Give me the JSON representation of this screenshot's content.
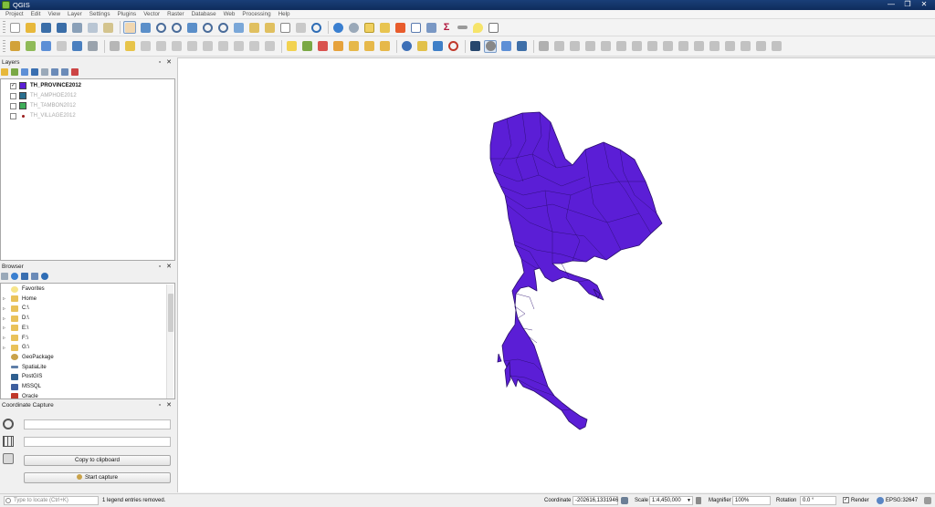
{
  "window": {
    "title": "QGIS",
    "minimize": "—",
    "maximize": "❐",
    "close": "✕"
  },
  "menus": [
    "Project",
    "Edit",
    "View",
    "Layer",
    "Settings",
    "Plugins",
    "Vector",
    "Raster",
    "Database",
    "Web",
    "Processing",
    "Help"
  ],
  "colors": {
    "province_fill": "#5b1ed6",
    "province_stroke": "#2a0e6e",
    "amphoe": "#2a6f8f",
    "tambon": "#3fae5a",
    "village": "#9b1c1c"
  },
  "layers_panel": {
    "title": "Layers",
    "layers": [
      {
        "name": "TH_PROVINCE2012",
        "checked": true,
        "symbol": "purple-fill"
      },
      {
        "name": "TH_AMPHOE2012",
        "checked": false,
        "symbol": "teal-fill"
      },
      {
        "name": "TH_TAMBON2012",
        "checked": false,
        "symbol": "green-fill"
      },
      {
        "name": "TH_VILLAGE2012",
        "checked": false,
        "symbol": "red-point"
      }
    ]
  },
  "browser_panel": {
    "title": "Browser",
    "items": [
      {
        "name": "Favorites",
        "icon": "star-icon"
      },
      {
        "name": "Home",
        "icon": "folder-icon"
      },
      {
        "name": "C:\\",
        "icon": "folder-icon"
      },
      {
        "name": "D:\\",
        "icon": "folder-icon"
      },
      {
        "name": "E:\\",
        "icon": "folder-icon"
      },
      {
        "name": "F:\\",
        "icon": "folder-icon"
      },
      {
        "name": "G:\\",
        "icon": "folder-icon"
      },
      {
        "name": "GeoPackage",
        "icon": "geopackage-icon"
      },
      {
        "name": "SpatiaLite",
        "icon": "spatialite-icon"
      },
      {
        "name": "PostGIS",
        "icon": "postgis-icon"
      },
      {
        "name": "MSSQL",
        "icon": "mssql-icon"
      },
      {
        "name": "Oracle",
        "icon": "oracle-icon"
      }
    ]
  },
  "coordinate_capture": {
    "title": "Coordinate Capture",
    "field1": "",
    "field2": "",
    "copy_label": "Copy to clipboard",
    "start_label": "Start capture"
  },
  "statusbar": {
    "locate_placeholder": "Type to locate (Ctrl+K)",
    "message": "1 legend entries removed.",
    "coordinate_label": "Coordinate",
    "coordinate_value": "-202616,1331946",
    "scale_label": "Scale",
    "scale_value": "1:4,450,000",
    "magnifier_label": "Magnifier",
    "magnifier_value": "100%",
    "rotation_label": "Rotation",
    "rotation_value": "0.0 °",
    "render_label": "Render",
    "crs": "EPSG:32647"
  }
}
